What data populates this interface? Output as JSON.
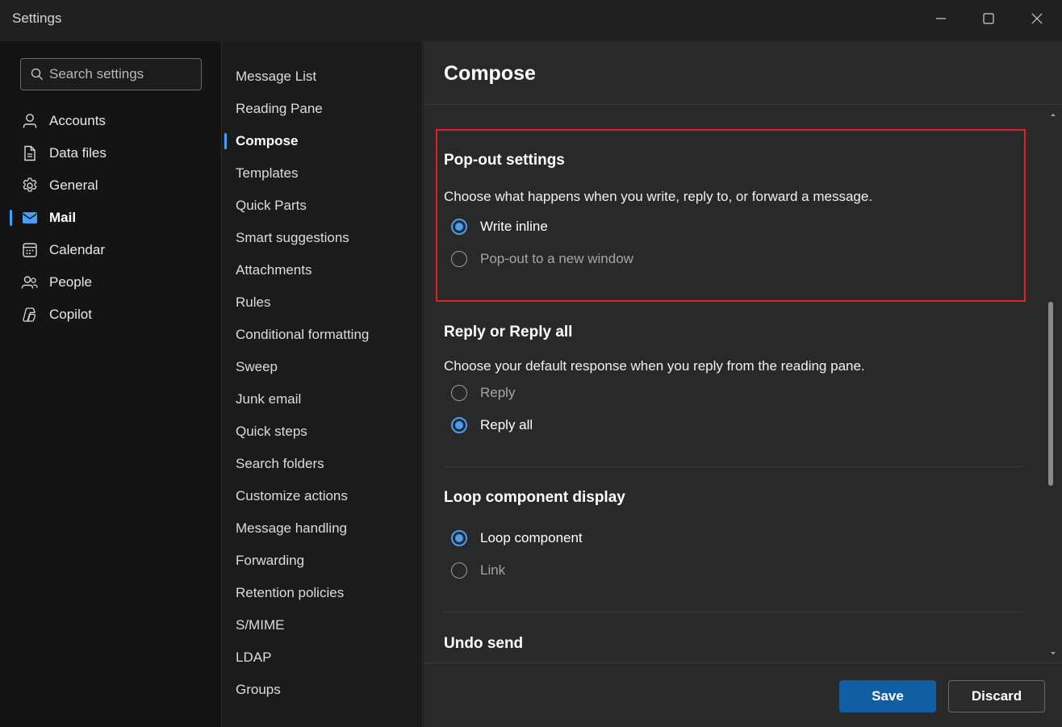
{
  "window": {
    "title": "Settings",
    "controls": [
      "minimize-icon",
      "maximize-icon",
      "close-icon"
    ]
  },
  "search": {
    "placeholder": "Search settings"
  },
  "left_nav": {
    "items": [
      {
        "label": "Accounts",
        "icon": "person-icon",
        "active": false
      },
      {
        "label": "Data files",
        "icon": "document-icon",
        "active": false
      },
      {
        "label": "General",
        "icon": "gear-icon",
        "active": false
      },
      {
        "label": "Mail",
        "icon": "mail-icon",
        "active": true
      },
      {
        "label": "Calendar",
        "icon": "calendar-icon",
        "active": false
      },
      {
        "label": "People",
        "icon": "people-icon",
        "active": false
      },
      {
        "label": "Copilot",
        "icon": "copilot-icon",
        "active": false
      }
    ]
  },
  "mid_nav": {
    "items": [
      "Message List",
      "Reading Pane",
      "Compose",
      "Templates",
      "Quick Parts",
      "Smart suggestions",
      "Attachments",
      "Rules",
      "Conditional formatting",
      "Sweep",
      "Junk email",
      "Quick steps",
      "Search folders",
      "Customize actions",
      "Message handling",
      "Forwarding",
      "Retention policies",
      "S/MIME",
      "LDAP",
      "Groups"
    ],
    "active": "Compose"
  },
  "content": {
    "title": "Compose",
    "sections": [
      {
        "title": "Pop-out settings",
        "desc": "Choose what happens when you write, reply to, or forward a message.",
        "options": [
          {
            "label": "Write inline",
            "checked": true
          },
          {
            "label": "Pop-out to a new window",
            "checked": false
          }
        ]
      },
      {
        "title": "Reply or Reply all",
        "desc": "Choose your default response when you reply from the reading pane.",
        "options": [
          {
            "label": "Reply",
            "checked": false
          },
          {
            "label": "Reply all",
            "checked": true
          }
        ]
      },
      {
        "title": "Loop component display",
        "options": [
          {
            "label": "Loop component",
            "checked": true
          },
          {
            "label": "Link",
            "checked": false
          }
        ]
      },
      {
        "title": "Undo send"
      }
    ]
  },
  "footer": {
    "save_label": "Save",
    "discard_label": "Discard"
  },
  "colors": {
    "accent": "#479ef5",
    "save_button": "#115ea3",
    "highlight": "#e0202a"
  }
}
